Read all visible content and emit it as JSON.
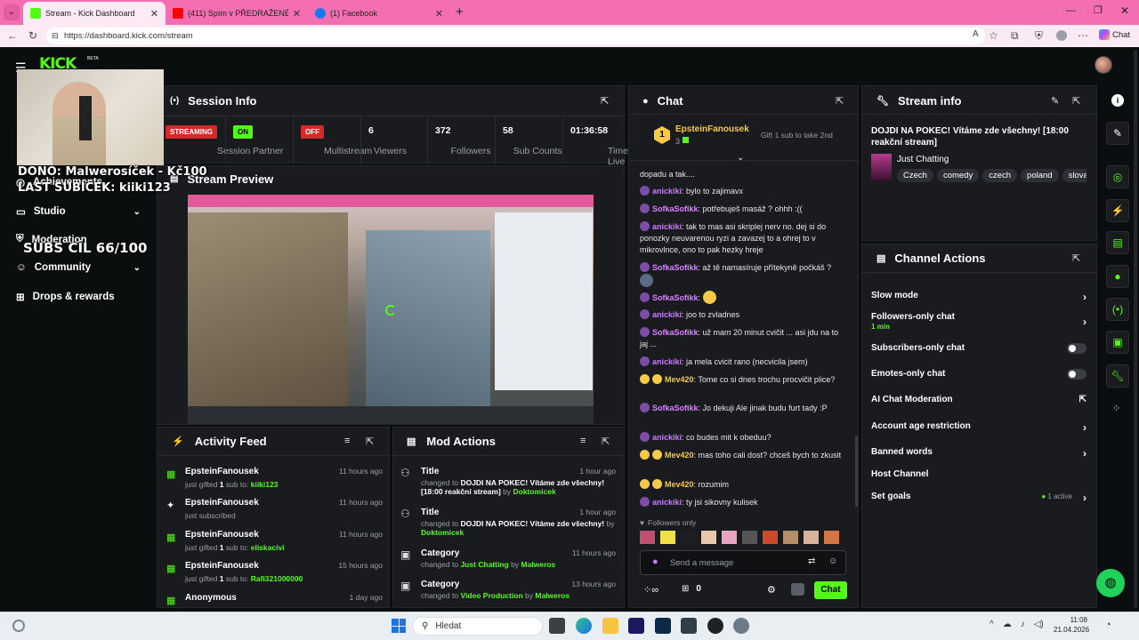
{
  "browser": {
    "tabs": [
      {
        "label": "Stream - Kick Dashboard",
        "favicon_color": "#53fc18"
      },
      {
        "label": "(411) Spím v PŘEDRAŽENÉM Hus",
        "favicon_color": "#ff0000"
      },
      {
        "label": "(1) Facebook",
        "favicon_color": "#1877f2"
      }
    ],
    "url": "https://dashboard.kick.com/stream",
    "chat_label": "Chat"
  },
  "brand": {
    "logo": "KICK",
    "beta": "BETA"
  },
  "overlay": {
    "dono": "DONO: Malwerosíček - Kč100",
    "last_sub": "LAST SUBÍČEK: kiiki123",
    "subs_goal": "SUBS CÍL 66/100"
  },
  "sidebar": {
    "items": [
      {
        "label": "Achievements"
      },
      {
        "label": "Studio"
      },
      {
        "label": "Moderation"
      },
      {
        "label": "Community"
      },
      {
        "label": "Drops & rewards"
      }
    ]
  },
  "session": {
    "title": "Session Info",
    "stats": [
      {
        "badge": "STREAMING",
        "label": "Session"
      },
      {
        "badge": "ON",
        "label": "Partner"
      },
      {
        "badge": "OFF",
        "label": "Multistream"
      },
      {
        "value": "6",
        "label": "Viewers"
      },
      {
        "value": "372",
        "label": "Followers"
      },
      {
        "value": "58",
        "label": "Sub Counts"
      },
      {
        "value": "01:36:58",
        "label": "Time Live"
      }
    ]
  },
  "preview": {
    "title": "Stream Preview"
  },
  "activity": {
    "title": "Activity Feed",
    "rows": [
      {
        "name": "EpsteinFanousek",
        "time": "11 hours ago",
        "pre": "just gifted ",
        "n": "1",
        "mid": " sub to: ",
        "target": "kiiki123"
      },
      {
        "name": "EpsteinFanousek",
        "time": "11 hours ago",
        "pre": "just subscribed",
        "n": "",
        "mid": "",
        "target": ""
      },
      {
        "name": "EpsteinFanousek",
        "time": "11 hours ago",
        "pre": "just gifted ",
        "n": "1",
        "mid": " sub to: ",
        "target": "eliskacivi"
      },
      {
        "name": "EpsteinFanousek",
        "time": "15 hours ago",
        "pre": "just gifted ",
        "n": "1",
        "mid": " sub to: ",
        "target": "Rafi321000000"
      },
      {
        "name": "Anonymous",
        "time": "1 day ago",
        "pre": "",
        "n": "",
        "mid": "",
        "target": ""
      }
    ]
  },
  "mod": {
    "title": "Mod Actions",
    "rows": [
      {
        "t": "Title",
        "time": "1 hour ago",
        "pre": "changed to ",
        "v": "DOJDI NA POKEC! Vítáme zde všechny! [18:00 reakční stream]",
        "by": " by ",
        "who": "Doktomicek"
      },
      {
        "t": "Title",
        "time": "1 hour ago",
        "pre": "changed to ",
        "v": "DOJDI NA POKEC! Vítáme zde všechny!",
        "by": " by ",
        "who": "Doktomicek"
      },
      {
        "t": "Category",
        "time": "11 hours ago",
        "pre": "changed to ",
        "v": "Just Chatting",
        "by": " by ",
        "who": "Malweros"
      },
      {
        "t": "Category",
        "time": "13 hours ago",
        "pre": "changed to ",
        "v": "Video Production",
        "by": " by ",
        "who": "Malweros"
      }
    ]
  },
  "chat": {
    "title": "Chat",
    "pinned_rank": "1",
    "pinned_user": "EpsteinFanousek",
    "pinned_count": "3",
    "gift_cta": "Gift 1 sub to take 2nd",
    "messages": [
      {
        "u": "",
        "m": "dopadu a tak...."
      },
      {
        "u": "anickikí",
        "m": ": bylo to zajimavx"
      },
      {
        "u": "SofkaSofikk",
        "m": ": potřebuješ masáž ? ohhh :(("
      },
      {
        "u": "anickikí",
        "m": ": tak to mas asi skriplej nerv no. dej si do ponozky neuvarenou ryzi a zavazej to a ohrej to v mikrovlnce, ono to pak hezky hreje"
      },
      {
        "u": "SofkaSofikk",
        "m": ": až tě namasíruje přítekyně počkáš ?"
      },
      {
        "u": "SofkaSofikk",
        "m": ":"
      },
      {
        "u": "anickikí",
        "m": ": joo to zvladnes"
      },
      {
        "u": "SofkaSofikk",
        "m": ": už mam 20 minut cvičit ... asi jdu na to jaj ..."
      },
      {
        "u": "anickikí",
        "m": ": ja mela cvicit rano (necvicila jsem)"
      },
      {
        "u": "Mev420",
        "m": ": Tome co si dnes trochu procvičit plice?"
      },
      {
        "u": "SofkaSofikk",
        "m": ": Jo dekuji  Ale jinak budu furt tady :P"
      },
      {
        "u": "anickikí",
        "m": ": co budes mit k obeduu?"
      },
      {
        "u": "Mev420",
        "m": ": mas toho cali dost? chceš bych to zkusit"
      },
      {
        "u": "Mev420",
        "m": ": rozumim"
      },
      {
        "u": "anickikí",
        "m": ": ty jsi sikovny kulisek"
      }
    ],
    "followers_only": "Followers only",
    "input_placeholder": "Send a message",
    "gift_count": "0",
    "send_label": "Chat"
  },
  "stream_info": {
    "title": "Stream info",
    "stream_title": "DOJDI NA POKEC! Vítáme zde všechny! [18:00 reakční stream]",
    "category": "Just Chatting",
    "tags": [
      "Czech",
      "comedy",
      "czech",
      "poland",
      "slova"
    ]
  },
  "channel_actions": {
    "title": "Channel Actions",
    "items": [
      {
        "label": "Slow mode",
        "kind": "arrow"
      },
      {
        "label": "Followers-only chat",
        "kind": "arrow",
        "sub": "1 min"
      },
      {
        "label": "Subscribers-only chat",
        "kind": "toggle"
      },
      {
        "label": "Emotes-only chat",
        "kind": "toggle"
      },
      {
        "label": "AI Chat Moderation",
        "kind": "external"
      },
      {
        "label": "Account age restriction",
        "kind": "arrow"
      },
      {
        "label": "Banned words",
        "kind": "arrow"
      },
      {
        "label": "Host Channel",
        "kind": "none"
      },
      {
        "label": "Set goals",
        "kind": "arrow",
        "extra": "1 active"
      }
    ]
  },
  "taskbar": {
    "search_placeholder": "Hledat",
    "time": "11:08",
    "date": "21.04.2026"
  },
  "colors": {
    "accent": "#53fc18",
    "panel": "#191b1f",
    "bg": "#0b0e0f",
    "tab_strip": "#f36fb2"
  }
}
